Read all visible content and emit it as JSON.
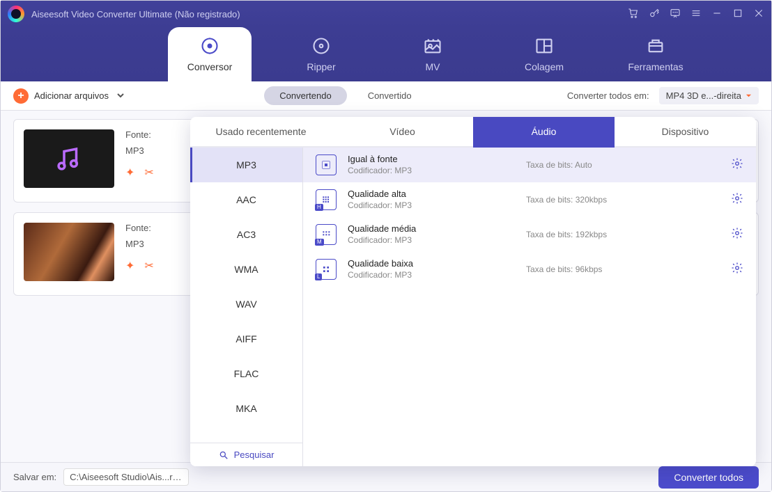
{
  "title": "Aiseesoft Video Converter Ultimate (Não registrado)",
  "nav": {
    "tabs": [
      "Conversor",
      "Ripper",
      "MV",
      "Colagem",
      "Ferramentas"
    ],
    "active": 0
  },
  "toolbar": {
    "add_files": "Adicionar arquivos",
    "converting": "Convertendo",
    "converted": "Convertido",
    "convert_all_in_label": "Converter todos em:",
    "convert_all_format": "MP4 3D e...-direita"
  },
  "items": [
    {
      "source_label": "Fonte:",
      "format": "MP3"
    },
    {
      "source_label": "Fonte:",
      "format": "MP3"
    }
  ],
  "bottom": {
    "save_in_label": "Salvar em:",
    "path": "C:\\Aiseesoft Studio\\Ais...rter",
    "convert_all_btn": "Converter todos"
  },
  "popup": {
    "tabs": [
      "Usado recentemente",
      "Vídeo",
      "Áudio",
      "Dispositivo"
    ],
    "active_tab": 2,
    "side_formats": [
      "MP3",
      "AAC",
      "AC3",
      "WMA",
      "WAV",
      "AIFF",
      "FLAC",
      "MKA"
    ],
    "side_active": 0,
    "search_label": "Pesquisar",
    "presets": [
      {
        "title": "Igual à fonte",
        "encoder_label": "Codificador:",
        "encoder": "MP3",
        "bitrate_label": "Taxa de bits:",
        "bitrate": "Auto",
        "badge": ""
      },
      {
        "title": "Qualidade alta",
        "encoder_label": "Codificador:",
        "encoder": "MP3",
        "bitrate_label": "Taxa de bits:",
        "bitrate": "320kbps",
        "badge": "H"
      },
      {
        "title": "Qualidade média",
        "encoder_label": "Codificador:",
        "encoder": "MP3",
        "bitrate_label": "Taxa de bits:",
        "bitrate": "192kbps",
        "badge": "M"
      },
      {
        "title": "Qualidade baixa",
        "encoder_label": "Codificador:",
        "encoder": "MP3",
        "bitrate_label": "Taxa de bits:",
        "bitrate": "96kbps",
        "badge": "L"
      }
    ]
  }
}
